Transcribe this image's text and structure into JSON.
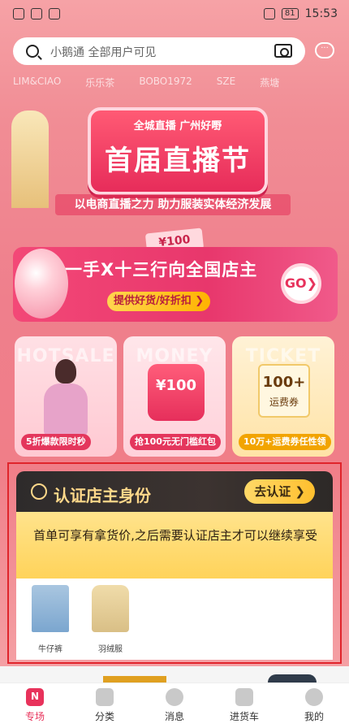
{
  "status_bar": {
    "battery": "81",
    "time": "15:53"
  },
  "search": {
    "placeholder": "小鹅通 全部用户可见"
  },
  "brands": [
    "LIM&CIAO",
    "乐乐茶",
    "BOBO1972",
    "SZE",
    "燕塘"
  ],
  "banner": {
    "subtitle": "全城直播 广州好嘢",
    "title": "首届直播节",
    "slogan": "以电商直播之力 助力服装实体经济发展",
    "ticket": "¥100",
    "strip_title": "一手X十三行向全国店主",
    "strip_pill": "提供好货/好折扣",
    "go": "GO"
  },
  "promo_cards": [
    {
      "bg_word": "HOTSALE",
      "tag": "5折爆款限时秒"
    },
    {
      "bg_word": "MONEY",
      "value": "¥100",
      "tag": "抢100元无门槛红包"
    },
    {
      "bg_word": "TICKET",
      "value": "100+",
      "label": "运费券",
      "tag": "10万+运费券任性领"
    }
  ],
  "certification": {
    "title": "认证店主身份",
    "button": "去认证",
    "message": "首单可享有拿货价,之后需要认证店主才可以继续享受",
    "categories": [
      {
        "label": "牛仔裤"
      },
      {
        "label": "羽绒服"
      }
    ]
  },
  "bottom_nav": [
    {
      "label": "专场",
      "active": true
    },
    {
      "label": "分类",
      "active": false
    },
    {
      "label": "消息",
      "active": false
    },
    {
      "label": "进货车",
      "active": false
    },
    {
      "label": "我的",
      "active": false
    }
  ],
  "colors": {
    "accent": "#e8325b",
    "cert_outline": "#e0242b",
    "gold": "#ffd88a"
  }
}
